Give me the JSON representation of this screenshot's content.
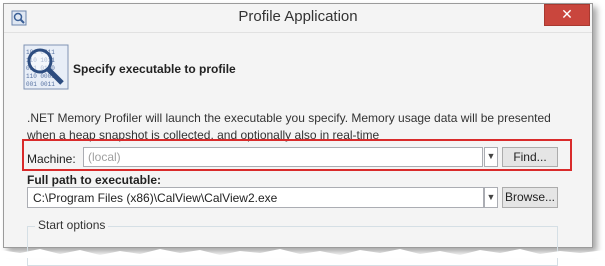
{
  "window": {
    "title": "Profile Application",
    "close_glyph": "✕"
  },
  "icons": {
    "app": "profiler-icon",
    "header": "magnifier-binary-icon"
  },
  "header": {
    "heading": "Specify executable to profile"
  },
  "description": ".NET Memory Profiler will launch the executable you specify. Memory usage data will be presented when a heap snapshot is collected, and optionally also in real-time",
  "machine": {
    "label": "Machine:",
    "placeholder": "(local)",
    "find_label": "Find..."
  },
  "path": {
    "label": "Full path to executable:",
    "value": "C:\\Program Files (x86)\\CalView\\CalView2.exe",
    "browse_label": "Browse..."
  },
  "start_options": {
    "title": "Start options"
  },
  "colors": {
    "highlight": "#d92b2b",
    "close": "#c9463d"
  }
}
